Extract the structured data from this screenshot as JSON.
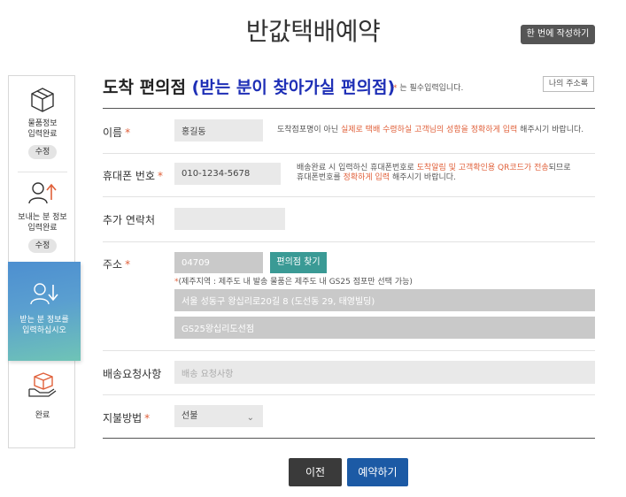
{
  "header": {
    "title": "반값택배예약",
    "one_time_button": "한 번에 작성하기"
  },
  "sidebar": {
    "steps": [
      {
        "label_line1": "물품정보",
        "label_line2": "입력완료",
        "badge": "수정",
        "icon": "box-icon"
      },
      {
        "label_line1": "보내는 분 정보",
        "label_line2": "입력완료",
        "badge": "수정",
        "icon": "sender-icon"
      },
      {
        "label_line1": "받는 분 정보를",
        "label_line2": "입력하십시오",
        "icon": "receiver-icon"
      },
      {
        "label_line1": "완료",
        "icon": "hand-box-icon"
      }
    ]
  },
  "section": {
    "title_main": "도착 편의점",
    "title_sub": "(받는 분이 찾아가실 편의점)",
    "required_note_star": "*",
    "required_note": "는 필수입력입니다.",
    "address_book_button": "나의 주소록"
  },
  "form": {
    "name": {
      "label": "이름",
      "required": "*",
      "value": "홍길동",
      "help_before": "도착점포명이 아닌 ",
      "help_highlight": "실제로 택배 수령하실 고객님의 성함을 정확하게 입력",
      "help_after": " 해주시기 바랍니다."
    },
    "phone": {
      "label": "휴대폰 번호",
      "required": "*",
      "value": "010-1234-5678",
      "help_line1_before": "배송완료 시 입력하신 휴대폰번호로 ",
      "help_line1_highlight": "도착알림 및 고객확인용 QR코드가 전송",
      "help_line1_after": "되므로",
      "help_line2_before": "휴대폰번호를 ",
      "help_line2_highlight": "정확하게 입력",
      "help_line2_after": " 해주시기 바랍니다."
    },
    "extra_contact": {
      "label": "추가 연락처",
      "value": ""
    },
    "address": {
      "label": "주소",
      "required": "*",
      "zipcode": "04709",
      "find_button": "편의점 찾기",
      "jeju_star": "*",
      "jeju_note": "(제주지역 : 제주도 내 발송 물품은 제주도 내 GS25 점포만 선택 가능)",
      "road_address": "서울 성동구 왕십리로20길 8 (도선동 29, 태영빌딩)",
      "store_name": "GS25왕십리도선점"
    },
    "delivery_request": {
      "label": "배송요청사항",
      "placeholder": "배송 요청사항"
    },
    "payment": {
      "label": "지불방법",
      "required": "*",
      "selected": "선불"
    }
  },
  "buttons": {
    "prev": "이전",
    "submit": "예약하기"
  },
  "colors": {
    "accent_blue": "#1e2fb6",
    "required_orange": "#e0603a",
    "find_button_teal": "#3a9a95",
    "submit_blue": "#1c5aa5"
  }
}
